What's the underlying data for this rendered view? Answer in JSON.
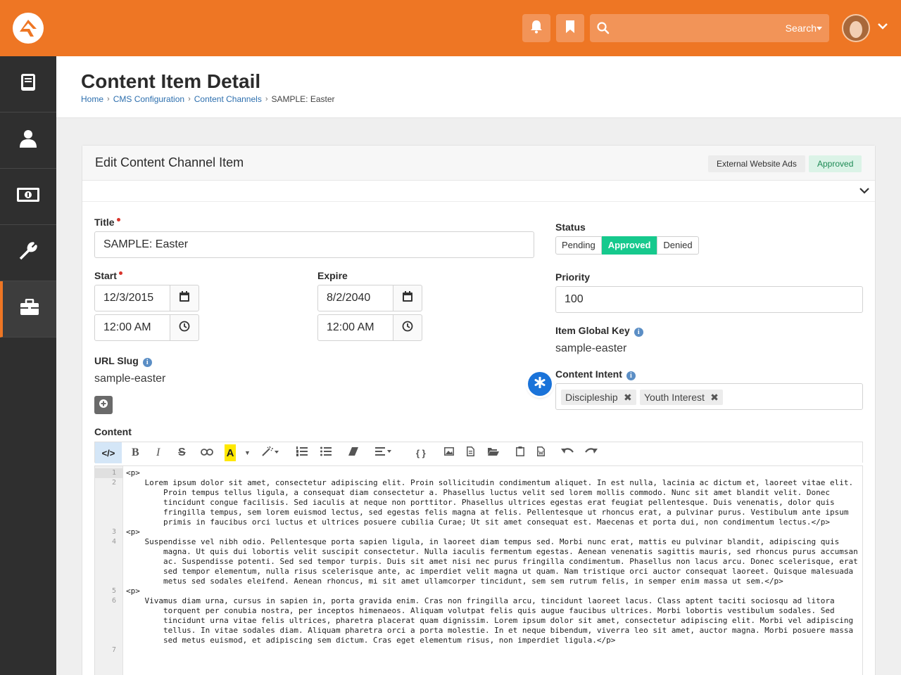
{
  "app": {
    "colors": {
      "brand": "#ee7624",
      "sidebar": "#2f2f2f",
      "approved": "#16c98d",
      "link": "#2d6fae"
    }
  },
  "topbar": {
    "search": {
      "label": "Search"
    },
    "icons": [
      "bell-icon",
      "bookmark-icon",
      "search-icon",
      "user-avatar",
      "chevron-down-icon"
    ]
  },
  "sidebar": {
    "items": [
      {
        "name": "book-icon"
      },
      {
        "name": "person-icon"
      },
      {
        "name": "money-icon"
      },
      {
        "name": "wrench-icon"
      },
      {
        "name": "briefcase-icon",
        "active": true
      }
    ]
  },
  "page": {
    "title": "Content Item Detail",
    "breadcrumb": [
      "Home",
      "CMS Configuration",
      "Content Channels",
      "SAMPLE: Easter"
    ]
  },
  "panel": {
    "title": "Edit Content Channel Item",
    "tags": {
      "channel": "External Website Ads",
      "status": "Approved"
    }
  },
  "form": {
    "title": {
      "label": "Title",
      "value": "SAMPLE: Easter"
    },
    "start": {
      "label": "Start",
      "date": "12/3/2015",
      "time": "12:00 AM"
    },
    "expire": {
      "label": "Expire",
      "date": "8/2/2040",
      "time": "12:00 AM"
    },
    "url_slug": {
      "label": "URL Slug",
      "value": "sample-easter"
    },
    "status": {
      "label": "Status",
      "options": [
        "Pending",
        "Approved",
        "Denied"
      ],
      "selected": "Approved"
    },
    "priority": {
      "label": "Priority",
      "value": "100"
    },
    "global_key": {
      "label": "Item Global Key",
      "value": "sample-easter"
    },
    "content_intent": {
      "label": "Content Intent",
      "chips": [
        "Discipleship",
        "Youth Interest"
      ]
    },
    "content": {
      "label": "Content"
    }
  },
  "editor": {
    "lines": [
      {
        "n": "1",
        "text": "<p>"
      },
      {
        "n": "2",
        "text": "    Lorem ipsum dolor sit amet, consectetur adipiscing elit. Proin sollicitudin condimentum aliquet. In est nulla, lacinia ac dictum et, laoreet vitae elit.\n        Proin tempus tellus ligula, a consequat diam consectetur a. Phasellus luctus velit sed lorem mollis commodo. Nunc sit amet blandit velit. Donec\n        tincidunt congue facilisis. Sed iaculis at neque non porttitor. Phasellus ultrices egestas erat feugiat pellentesque. Duis venenatis, dolor quis\n        fringilla tempus, sem lorem euismod lectus, sed egestas felis magna at felis. Pellentesque ut rhoncus erat, a pulvinar purus. Vestibulum ante ipsum\n        primis in faucibus orci luctus et ultrices posuere cubilia Curae; Ut sit amet consequat est. Maecenas et porta dui, non condimentum lectus.</p>"
      },
      {
        "n": "3",
        "text": "<p>"
      },
      {
        "n": "4",
        "text": "    Suspendisse vel nibh odio. Pellentesque porta sapien ligula, in laoreet diam tempus sed. Morbi nunc erat, mattis eu pulvinar blandit, adipiscing quis\n        magna. Ut quis dui lobortis velit suscipit consectetur. Nulla iaculis fermentum egestas. Aenean venenatis sagittis mauris, sed rhoncus purus accumsan\n        ac. Suspendisse potenti. Sed sed tempor turpis. Duis sit amet nisi nec purus fringilla condimentum. Phasellus non lacus arcu. Donec scelerisque, erat\n        sed tempor elementum, nulla risus scelerisque ante, ac imperdiet velit magna ut quam. Nam tristique orci auctor consequat laoreet. Quisque malesuada\n        metus sed sodales eleifend. Aenean rhoncus, mi sit amet ullamcorper tincidunt, sem sem rutrum felis, in semper enim massa ut sem.</p>"
      },
      {
        "n": "5",
        "text": "<p>"
      },
      {
        "n": "6",
        "text": "    Vivamus diam urna, cursus in sapien in, porta gravida enim. Cras non fringilla arcu, tincidunt laoreet lacus. Class aptent taciti sociosqu ad litora\n        torquent per conubia nostra, per inceptos himenaeos. Aliquam volutpat felis quis augue faucibus ultrices. Morbi lobortis vestibulum sodales. Sed\n        tincidunt urna vitae felis ultrices, pharetra placerat quam dignissim. Lorem ipsum dolor sit amet, consectetur adipiscing elit. Morbi vel adipiscing\n        tellus. In vitae sodales diam. Aliquam pharetra orci a porta molestie. In et neque bibendum, viverra leo sit amet, auctor magna. Morbi posuere massa\n        sed metus euismod, et adipiscing sem dictum. Cras eget elementum risus, non imperdiet ligula.</p>"
      },
      {
        "n": "7",
        "text": ""
      }
    ]
  }
}
